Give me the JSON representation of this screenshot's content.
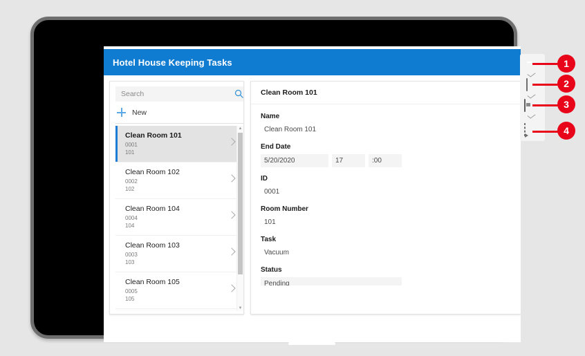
{
  "app": {
    "title": "Hotel House Keeping Tasks",
    "header_color": "#0f7bd1"
  },
  "search": {
    "placeholder": "Search",
    "value": "",
    "icon": "search-icon"
  },
  "new_button": {
    "label": "New",
    "icon": "plus-icon"
  },
  "list": {
    "items": [
      {
        "title": "Clean Room 101",
        "id": "0001",
        "room": "101",
        "selected": true
      },
      {
        "title": "Clean Room 102",
        "id": "0002",
        "room": "102",
        "selected": false
      },
      {
        "title": "Clean Room 104",
        "id": "0004",
        "room": "104",
        "selected": false
      },
      {
        "title": "Clean Room 103",
        "id": "0003",
        "room": "103",
        "selected": false
      },
      {
        "title": "Clean Room 105",
        "id": "0005",
        "room": "105",
        "selected": false
      }
    ],
    "scroll_up": "▲",
    "scroll_down": "▼"
  },
  "detail": {
    "title": "Clean Room 101",
    "fields": {
      "name_label": "Name",
      "name_value": "Clean Room 101",
      "enddate_label": "End Date",
      "enddate_date": "5/20/2020",
      "enddate_hour": "17",
      "enddate_minute": ":00",
      "id_label": "ID",
      "id_value": "0001",
      "room_label": "Room Number",
      "room_value": "101",
      "task_label": "Task",
      "task_value": "Vacuum",
      "status_label": "Status",
      "status_value": "Pending"
    }
  },
  "annotations": {
    "badge_color": "#e8051a",
    "items": [
      {
        "number": "1",
        "icon": "desktop-monitor-icon"
      },
      {
        "number": "2",
        "icon": "phone-device-icon"
      },
      {
        "number": "3",
        "icon": "browser-window-icon"
      },
      {
        "number": "4",
        "icon": "screenshot-snip-icon"
      }
    ]
  }
}
